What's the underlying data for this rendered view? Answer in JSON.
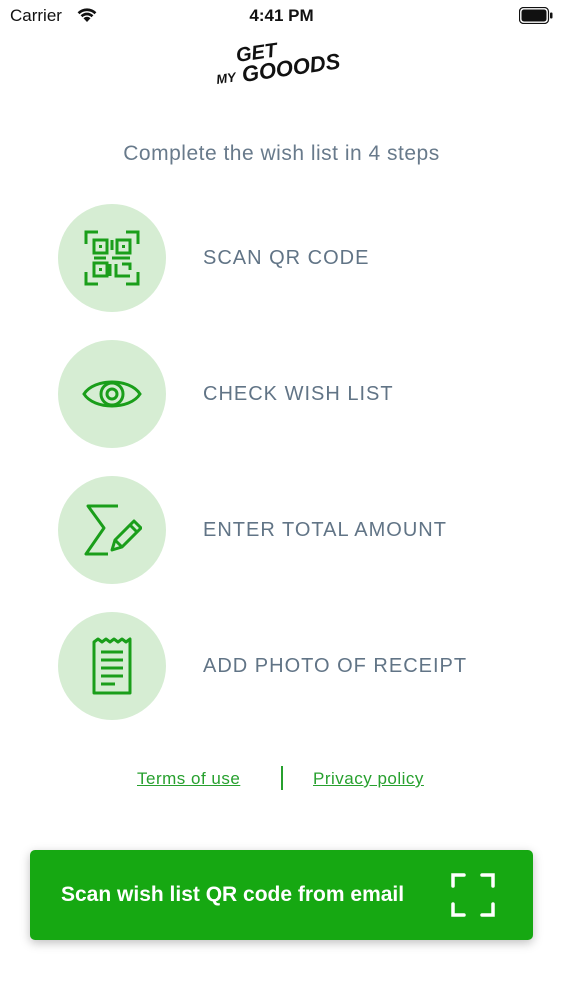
{
  "status_bar": {
    "carrier": "Carrier",
    "time": "4:41 PM"
  },
  "logo": {
    "line1": "GET",
    "line2": "MY",
    "line3": "GOOODS"
  },
  "subtitle": "Complete the wish list in 4 steps",
  "steps": [
    {
      "label": "SCAN QR CODE",
      "icon": "qr-code-icon"
    },
    {
      "label": "CHECK WISH LIST",
      "icon": "eye-icon"
    },
    {
      "label": "ENTER TOTAL AMOUNT",
      "icon": "sigma-pencil-icon"
    },
    {
      "label": "ADD PHOTO OF RECEIPT",
      "icon": "receipt-icon"
    }
  ],
  "links": {
    "terms": "Terms of use",
    "privacy": "Privacy policy"
  },
  "scan_button": {
    "label": "Scan wish list QR code from email",
    "icon": "scan-frame-icon"
  },
  "colors": {
    "accent": "#16a812",
    "step_circle": "#d6edd3",
    "link": "#27a02e",
    "text": "#617486"
  }
}
